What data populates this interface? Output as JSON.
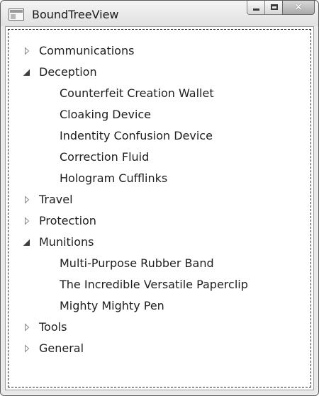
{
  "window": {
    "title": "BoundTreeView",
    "buttons": {
      "minimize": "minimize",
      "maximize": "maximize",
      "close": "close"
    }
  },
  "tree": {
    "items": [
      {
        "label": "Communications",
        "expanded": false,
        "children": []
      },
      {
        "label": "Deception",
        "expanded": true,
        "children": [
          {
            "label": "Counterfeit Creation Wallet"
          },
          {
            "label": "Cloaking Device"
          },
          {
            "label": "Indentity Confusion Device"
          },
          {
            "label": "Correction Fluid"
          },
          {
            "label": "Hologram Cufflinks"
          }
        ]
      },
      {
        "label": "Travel",
        "expanded": false,
        "children": []
      },
      {
        "label": "Protection",
        "expanded": false,
        "children": []
      },
      {
        "label": "Munitions",
        "expanded": true,
        "children": [
          {
            "label": "Multi-Purpose Rubber Band"
          },
          {
            "label": "The Incredible Versatile Paperclip"
          },
          {
            "label": "Mighty Mighty Pen"
          }
        ]
      },
      {
        "label": "Tools",
        "expanded": false,
        "children": []
      },
      {
        "label": "General",
        "expanded": false,
        "children": []
      }
    ]
  },
  "icons": {
    "collapsed": "triangle-right-outline-icon",
    "expanded": "triangle-down-filled-icon"
  },
  "colors": {
    "text": "#1e1e1e",
    "focus_border": "#2a2a2a",
    "expander_outline": "#8a8a8a",
    "expander_filled": "#404040"
  }
}
